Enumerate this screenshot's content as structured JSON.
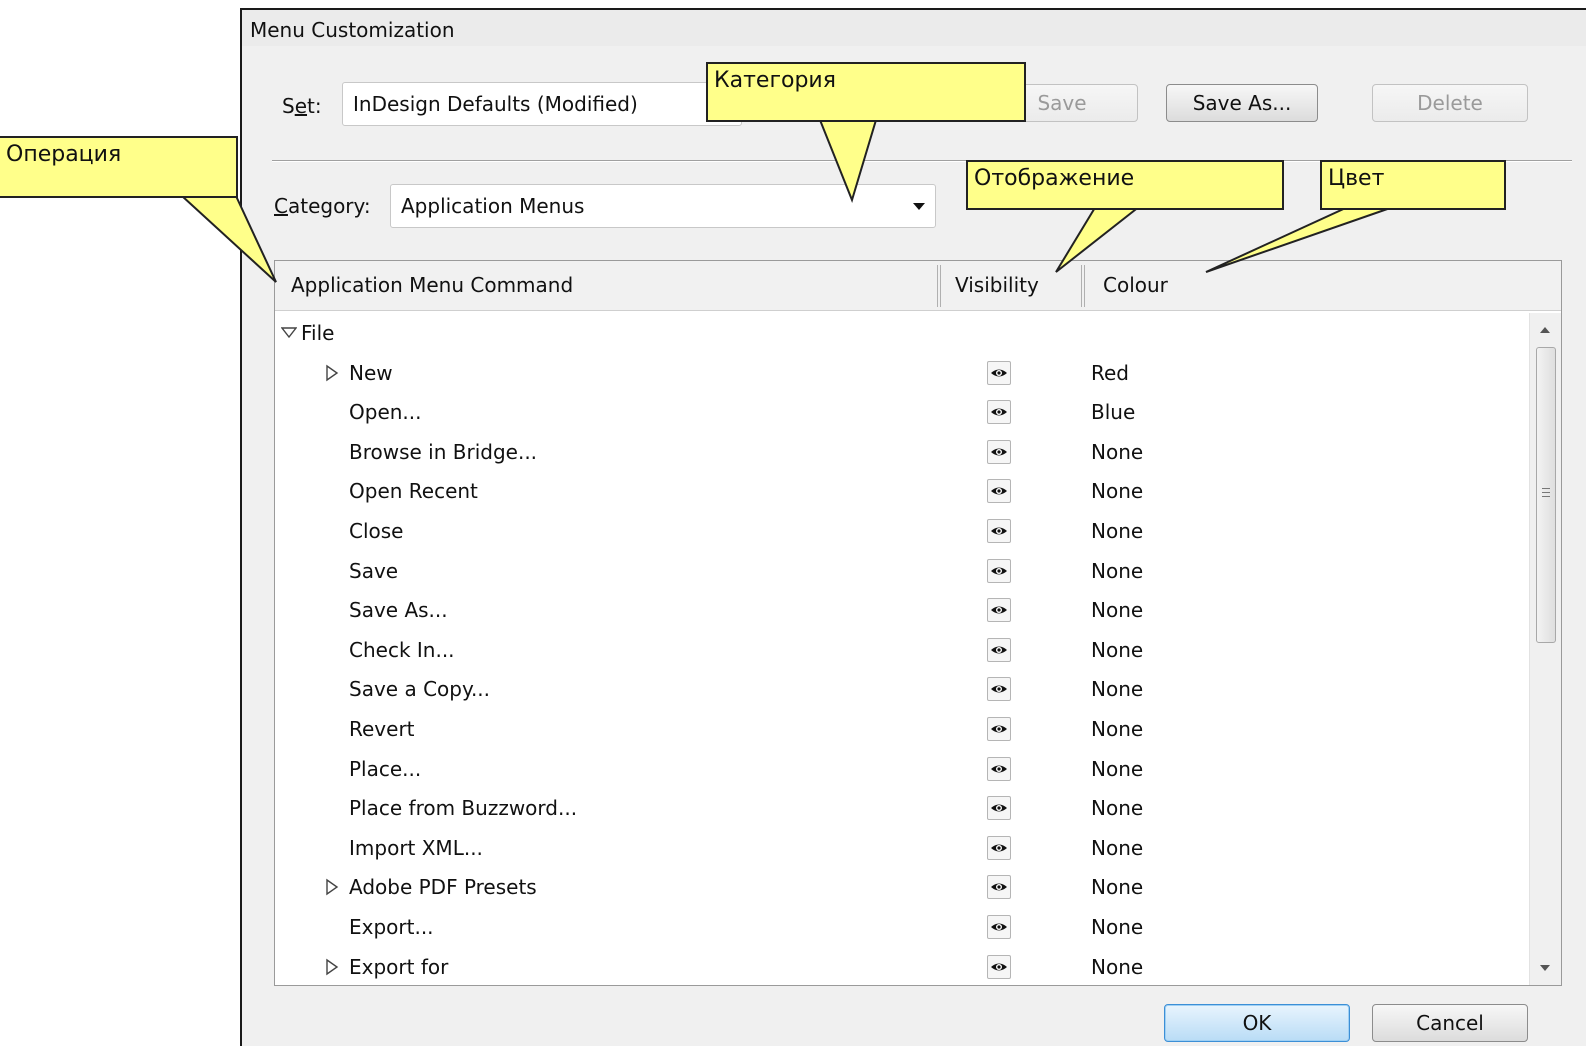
{
  "dialog": {
    "title": "Menu Customization",
    "set_label": "Set:",
    "set_value": "InDesign Defaults (Modified)",
    "save_label": "Save",
    "save_as_label": "Save As...",
    "delete_label": "Delete",
    "category_label": "Category:",
    "category_value": "Application Menus",
    "ok_label": "OK",
    "cancel_label": "Cancel"
  },
  "table": {
    "col_command": "Application Menu Command",
    "col_visibility": "Visibility",
    "col_colour": "Colour",
    "group": "File",
    "rows": [
      {
        "name": "New",
        "submenu": true,
        "colour": "Red"
      },
      {
        "name": "Open...",
        "submenu": false,
        "colour": "Blue"
      },
      {
        "name": "Browse in Bridge...",
        "submenu": false,
        "colour": "None"
      },
      {
        "name": "Open Recent",
        "submenu": false,
        "colour": "None"
      },
      {
        "name": "Close",
        "submenu": false,
        "colour": "None"
      },
      {
        "name": "Save",
        "submenu": false,
        "colour": "None"
      },
      {
        "name": "Save As...",
        "submenu": false,
        "colour": "None"
      },
      {
        "name": "Check In...",
        "submenu": false,
        "colour": "None"
      },
      {
        "name": "Save a Copy...",
        "submenu": false,
        "colour": "None"
      },
      {
        "name": "Revert",
        "submenu": false,
        "colour": "None"
      },
      {
        "name": "Place...",
        "submenu": false,
        "colour": "None"
      },
      {
        "name": "Place from Buzzword...",
        "submenu": false,
        "colour": "None"
      },
      {
        "name": "Import XML...",
        "submenu": false,
        "colour": "None"
      },
      {
        "name": "Adobe PDF Presets",
        "submenu": true,
        "colour": "None"
      },
      {
        "name": "Export...",
        "submenu": false,
        "colour": "None"
      },
      {
        "name": "Export for",
        "submenu": true,
        "colour": "None"
      }
    ],
    "visibility_icon": "eye-icon"
  },
  "callouts": {
    "operation": "Операция",
    "category": "Категория",
    "visibility": "Отображение",
    "colour": "Цвет"
  }
}
